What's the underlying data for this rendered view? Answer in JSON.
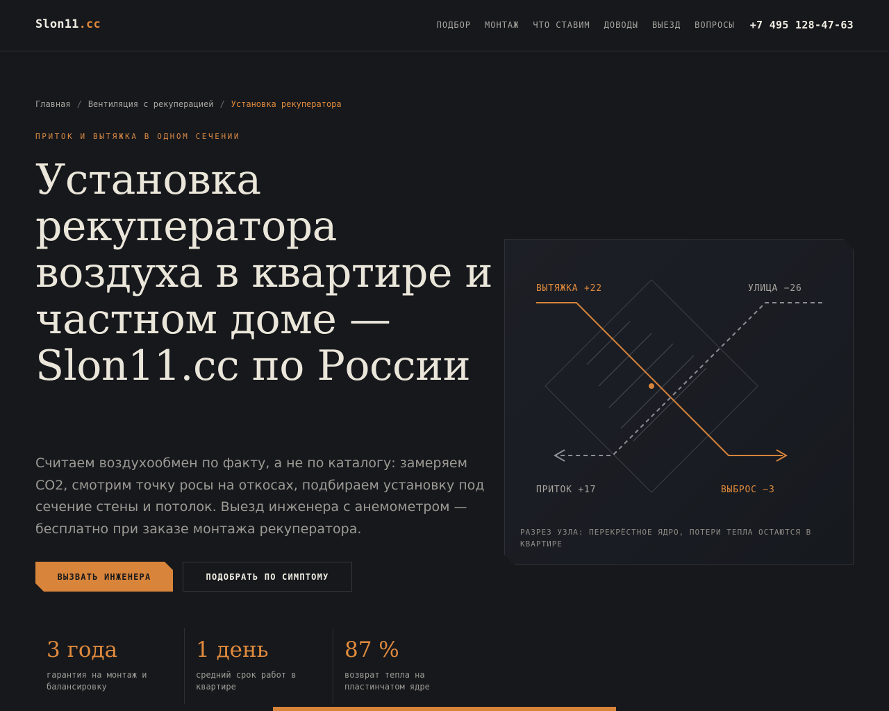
{
  "header": {
    "logo_main": "Slon11",
    "logo_accent": ".cc",
    "nav": [
      "ПОДБОР",
      "МОНТАЖ",
      "ЧТО СТАВИМ",
      "ДОВОДЫ",
      "ВЫЕЗД",
      "ВОПРОСЫ"
    ],
    "phone": "+7 495 128-47-63"
  },
  "breadcrumb": {
    "items": [
      "Главная",
      "Вентиляция с рекуперацией"
    ],
    "current": "Установка рекуператора",
    "separator": "/"
  },
  "hero": {
    "eyebrow": "ПРИТОК И ВЫТЯЖКА В ОДНОМ СЕЧЕНИИ",
    "title": "Установка рекуператора воздуха в квартире и частном доме — Slon11.cc по России",
    "lead": "Считаем воздухообмен по факту, а не по каталогу: замеряем CO2, смотрим точку росы на откосах, подбираем установку под сечение стены и потолок. Выезд инженера с анемометром — бесплатно при заказе монтажа рекуператора.",
    "primary_button": "ВЫЗВАТЬ ИНЖЕНЕРА",
    "secondary_button": "ПОДОБРАТЬ ПО СИМПТОМУ"
  },
  "diagram": {
    "label_exhaust": "ВЫТЯЖКА +22",
    "label_street": "УЛИЦА −26",
    "label_supply": "ПРИТОК +17",
    "label_discharge": "ВЫБРОС −3",
    "caption": "РАЗРЕЗ УЗЛА: ПЕРЕКРЁСТНОЕ ЯДРО, ПОТЕРИ ТЕПЛА ОСТАЮТСЯ В КВАРТИРЕ"
  },
  "stats": [
    {
      "value": "3 года",
      "label": "гарантия на монтаж и балансировку"
    },
    {
      "value": "1 день",
      "label": "средний срок работ в квартире"
    },
    {
      "value": "87 %",
      "label": "возврат тепла на пластинчатом ядре"
    }
  ],
  "colors": {
    "accent": "#d8843a",
    "background": "#16181c",
    "text": "#ebe6da",
    "muted": "#9d9a94"
  }
}
